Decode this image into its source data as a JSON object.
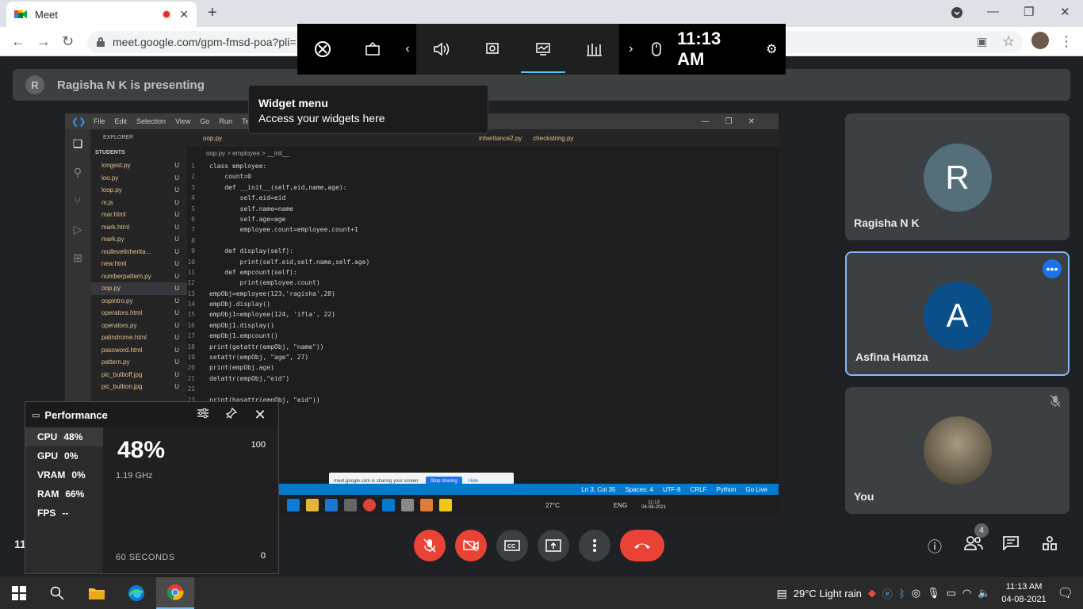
{
  "browser": {
    "tab_title": "Meet",
    "new_tab": "+",
    "url": "meet.google.com/gpm-fmsd-poa?pli="
  },
  "gamebar": {
    "time": "11:13 AM",
    "icons": [
      "xbox-icon",
      "capture-icon",
      "prev-icon",
      "audio-icon",
      "capture-widget-icon",
      "performance-icon",
      "resources-icon",
      "next-icon",
      "mouse-icon",
      "settings-icon"
    ]
  },
  "banner": {
    "avatar_letter": "R",
    "text": "Ragisha N K is presenting"
  },
  "widget_menu": {
    "title": "Widget menu",
    "subtitle": "Access your widgets here"
  },
  "vscode": {
    "menu": [
      "File",
      "Edit",
      "Selection",
      "View",
      "Go",
      "Run",
      "Termi"
    ],
    "explorer_title": "EXPLORER",
    "explorer_root": "STUDENTS",
    "files": [
      {
        "name": "longest.py",
        "flag": "U"
      },
      {
        "name": "loo.py",
        "flag": "U"
      },
      {
        "name": "loop.py",
        "flag": "U"
      },
      {
        "name": "m.js",
        "flag": "U"
      },
      {
        "name": "mar.html",
        "flag": "U"
      },
      {
        "name": "mark.html",
        "flag": "U"
      },
      {
        "name": "mark.py",
        "flag": "U"
      },
      {
        "name": "mullevelinherita...",
        "flag": "U"
      },
      {
        "name": "new.html",
        "flag": "U"
      },
      {
        "name": "numberpattern.py",
        "flag": "U"
      },
      {
        "name": "oop.py",
        "flag": "U"
      },
      {
        "name": "oopintro.py",
        "flag": "U"
      },
      {
        "name": "operators.html",
        "flag": "U"
      },
      {
        "name": "operators.py",
        "flag": "U"
      },
      {
        "name": "palindrome.html",
        "flag": "U"
      },
      {
        "name": "password.html",
        "flag": "U"
      },
      {
        "name": "pattern.py",
        "flag": "U"
      },
      {
        "name": "pic_bulboff.jpg",
        "flag": "U"
      },
      {
        "name": "pic_bulbon.jpg",
        "flag": "U"
      }
    ],
    "tabs": [
      "oop.py",
      "inheritance2.py",
      "checkstring.py"
    ],
    "breadcrumb": "oop.py > employee > __init__",
    "code": [
      {
        "n": "1",
        "t": "class employee:"
      },
      {
        "n": "2",
        "t": "    count=0"
      },
      {
        "n": "3",
        "t": "    def __init__(self,eid,name,age):"
      },
      {
        "n": "4",
        "t": "        self.eid=eid"
      },
      {
        "n": "5",
        "t": "        self.name=name"
      },
      {
        "n": "6",
        "t": "        self.age=age"
      },
      {
        "n": "7",
        "t": "        employee.count=employee.count+1"
      },
      {
        "n": "8",
        "t": ""
      },
      {
        "n": "9",
        "t": "    def display(self):"
      },
      {
        "n": "10",
        "t": "        print(self.eid,self.name,self.age)"
      },
      {
        "n": "11",
        "t": "    def empcount(self):"
      },
      {
        "n": "12",
        "t": "        print(employee.count)"
      },
      {
        "n": "13",
        "t": "empObj=employee(123,'ragisha',28)"
      },
      {
        "n": "14",
        "t": "empObj.display()"
      },
      {
        "n": "15",
        "t": "empObj1=employee(124, 'ifla', 22)"
      },
      {
        "n": "16",
        "t": "empObj1.display()"
      },
      {
        "n": "17",
        "t": "empObj1.empcount()"
      },
      {
        "n": "18",
        "t": "print(getattr(empObj, \"name\"))"
      },
      {
        "n": "19",
        "t": "setattr(empObj, \"age\", 27)"
      },
      {
        "n": "20",
        "t": "print(empObj.age)"
      },
      {
        "n": "21",
        "t": "delattr(empObj,\"eid\")"
      },
      {
        "n": "22",
        "t": ""
      },
      {
        "n": "23",
        "t": "print(hasattr(empObj, \"eid\"))"
      }
    ],
    "share_text": "meet.google.com is sharing your screen.",
    "share_stop": "Stop sharing",
    "share_hide": "Hide",
    "status": [
      "Ln 3, Col 35",
      "Spaces: 4",
      "UTF-8",
      "CRLF",
      "Python",
      "Go Live"
    ],
    "inner_tray": {
      "temp": "27°C",
      "lang": "ENG",
      "time": "11:13",
      "date": "04-08-2021"
    }
  },
  "participants": [
    {
      "letter": "R",
      "name": "Ragisha N K",
      "color": "#546e7a"
    },
    {
      "letter": "A",
      "name": "Asfina Hamza",
      "color": "#0b4f8a",
      "more": "•••"
    },
    {
      "letter": "",
      "name": "You",
      "color": "#5d4f3f"
    }
  ],
  "controls": {
    "people_count": "4",
    "meeting_time_prefix": "11"
  },
  "performance": {
    "title": "Performance",
    "metrics": [
      {
        "label": "CPU",
        "value": "48%"
      },
      {
        "label": "GPU",
        "value": "0%"
      },
      {
        "label": "VRAM",
        "value": "0%"
      },
      {
        "label": "RAM",
        "value": "66%"
      },
      {
        "label": "FPS",
        "value": "--"
      }
    ],
    "big_value": "48%",
    "freq": "1.19 GHz",
    "max": "100",
    "min": "0",
    "window": "60 SECONDS"
  },
  "taskbar": {
    "weather": "29°C  Light rain",
    "time": "11:13 AM",
    "date": "04-08-2021"
  }
}
